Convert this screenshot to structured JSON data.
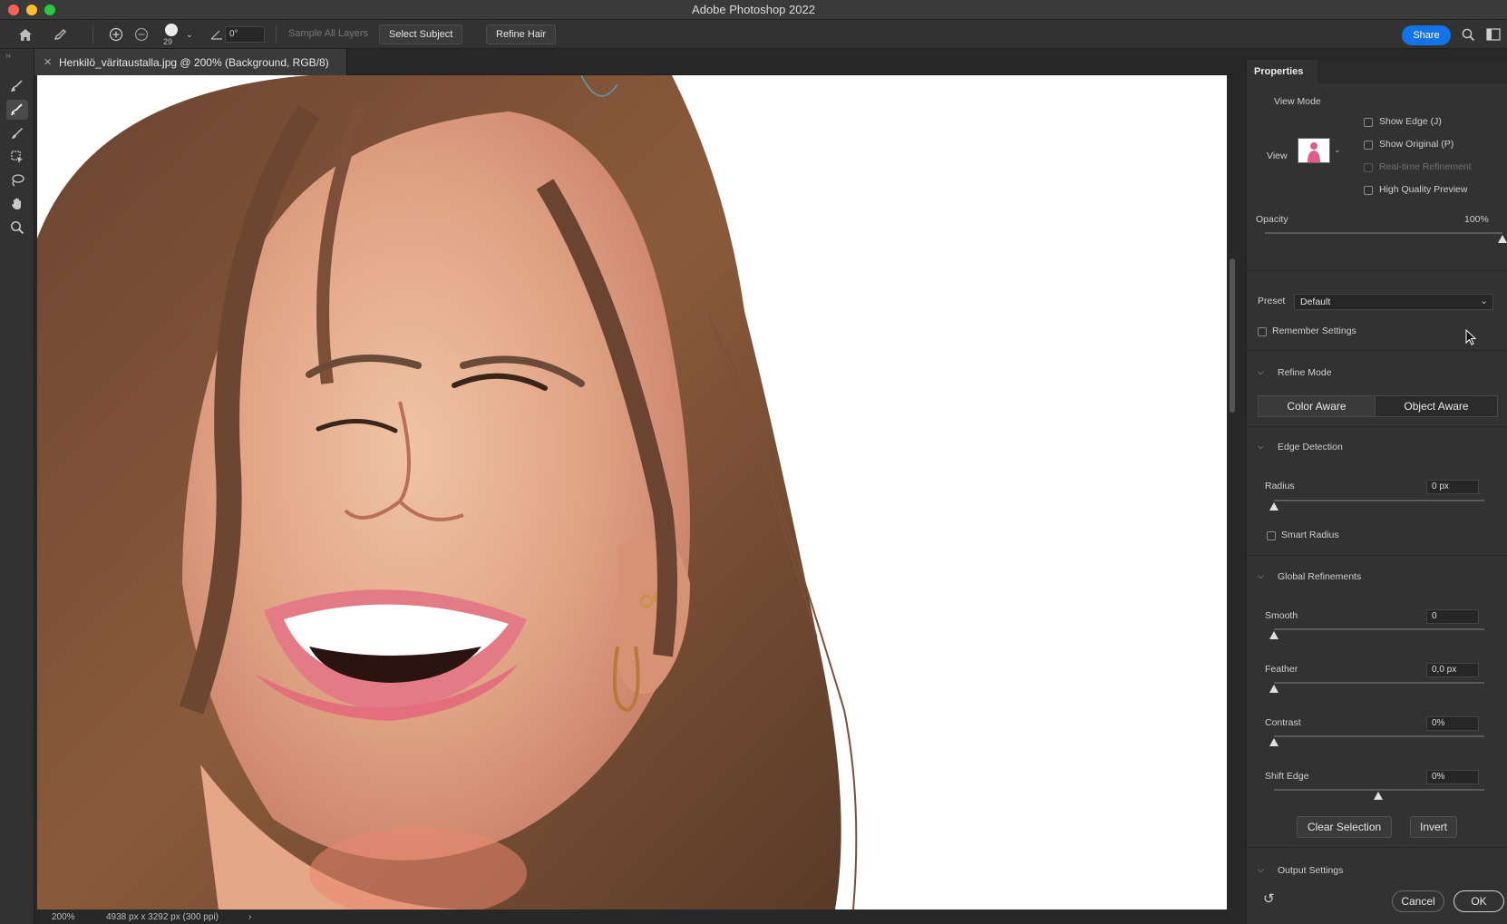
{
  "app": {
    "title": "Adobe Photoshop 2022"
  },
  "options_bar": {
    "brush_size": "29",
    "angle": "0°",
    "sample_all_layers": "Sample All Layers",
    "select_subject": "Select Subject",
    "refine_hair": "Refine Hair",
    "share": "Share",
    "icons": [
      "home-icon",
      "brush-tool-icon",
      "add-to-selection-icon",
      "subtract-from-selection-icon",
      "angle-icon",
      "search-icon",
      "workspace-icon"
    ]
  },
  "document": {
    "tab_title": "Henkilö_väritaustalla.jpg @ 200% (Background, RGB/8)",
    "zoom": "200%",
    "dimensions": "4938 px x 3292 px (300 ppi)",
    "status_arrow": "›"
  },
  "tools": [
    "quick-selection-icon",
    "refine-edge-brush-icon",
    "brush-icon",
    "object-selection-icon",
    "lasso-icon",
    "hand-icon",
    "zoom-icon"
  ],
  "properties": {
    "tab": "Properties",
    "view_mode": {
      "heading": "View Mode",
      "view_label": "View",
      "show_edge": "Show Edge (J)",
      "show_original": "Show Original (P)",
      "realtime_refinement": "Real-time Refinement",
      "high_quality_preview": "High Quality Preview"
    },
    "opacity": {
      "label": "Opacity",
      "value": "100%",
      "level": 1.0
    },
    "preset": {
      "label": "Preset",
      "value": "Default"
    },
    "remember_settings": "Remember Settings",
    "refine_mode": {
      "heading": "Refine Mode",
      "color_aware": "Color Aware",
      "object_aware": "Object Aware"
    },
    "edge_detection": {
      "heading": "Edge Detection",
      "radius_label": "Radius",
      "radius_value": "0 px",
      "smart_radius": "Smart Radius"
    },
    "global_refinements": {
      "heading": "Global Refinements",
      "smooth_label": "Smooth",
      "smooth_value": "0",
      "feather_label": "Feather",
      "feather_value": "0,0 px",
      "contrast_label": "Contrast",
      "contrast_value": "0%",
      "shift_edge_label": "Shift Edge",
      "shift_edge_value": "0%"
    },
    "clear_selection": "Clear Selection",
    "invert": "Invert",
    "output_settings": "Output Settings",
    "cancel": "Cancel",
    "ok": "OK"
  },
  "colors": {
    "accent": "#1473e6",
    "panel": "#323232",
    "canvas_bg": "#282828"
  }
}
